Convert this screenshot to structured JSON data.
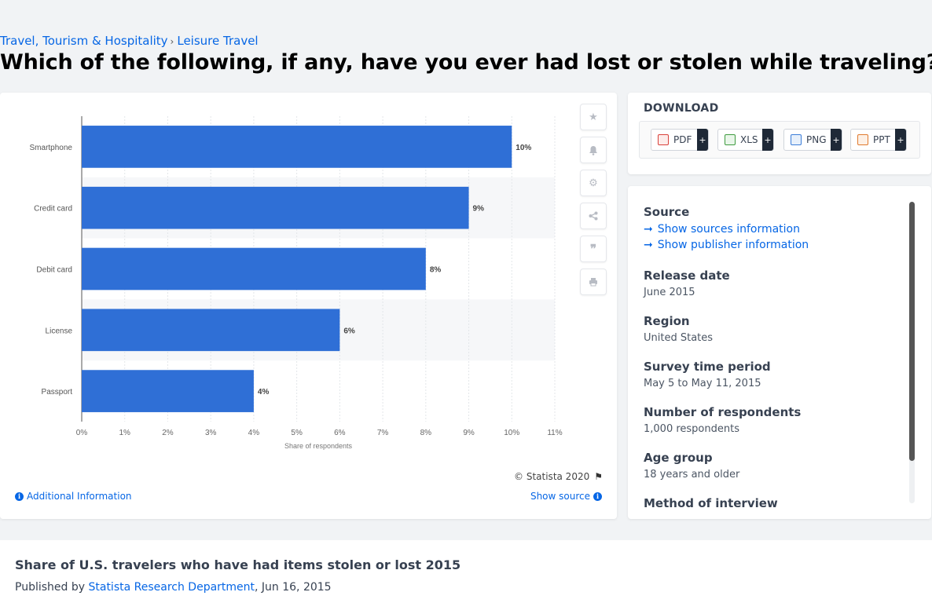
{
  "breadcrumb": {
    "category": "Travel, Tourism & Hospitality",
    "separator": "›",
    "subcategory": "Leisure Travel"
  },
  "page_title": "Which of the following, if any, have you ever had lost or stolen while traveling?",
  "chart_data": {
    "type": "bar",
    "orientation": "horizontal",
    "categories": [
      "Smartphone",
      "Credit card",
      "Debit card",
      "License",
      "Passport"
    ],
    "values": [
      10,
      9,
      8,
      6,
      4
    ],
    "value_labels": [
      "10%",
      "9%",
      "8%",
      "6%",
      "4%"
    ],
    "xlabel": "Share of respondents",
    "ylabel": "",
    "xlim": [
      0,
      11
    ],
    "x_ticks": [
      "0%",
      "1%",
      "2%",
      "3%",
      "4%",
      "5%",
      "6%",
      "7%",
      "8%",
      "9%",
      "10%",
      "11%"
    ],
    "grid": true,
    "bar_color": "#2f6fd6"
  },
  "chart_footer": {
    "copyright": "© Statista 2020",
    "additional_info": "Additional Information",
    "show_source": "Show source"
  },
  "toolbar": {
    "icons": [
      "star-icon",
      "bell-icon",
      "gear-icon",
      "share-icon",
      "quote-icon",
      "print-icon"
    ]
  },
  "download": {
    "title": "DOWNLOAD",
    "buttons": [
      {
        "label": "PDF",
        "plus": "+",
        "color": "#d9413b"
      },
      {
        "label": "XLS",
        "plus": "+",
        "color": "#3e9b3f"
      },
      {
        "label": "PNG",
        "plus": "+",
        "color": "#3b7dd8"
      },
      {
        "label": "PPT",
        "plus": "+",
        "color": "#e07a2e"
      }
    ]
  },
  "details": {
    "source_heading": "Source",
    "show_sources": "Show sources information",
    "show_publisher": "Show publisher information",
    "release_date_heading": "Release date",
    "release_date": "June 2015",
    "region_heading": "Region",
    "region": "United States",
    "survey_period_heading": "Survey time period",
    "survey_period": "May 5 to May 11, 2015",
    "respondents_heading": "Number of respondents",
    "respondents": "1,000 respondents",
    "age_group_heading": "Age group",
    "age_group": "18 years and older",
    "method_heading": "Method of interview"
  },
  "bottom": {
    "title": "Share of U.S. travelers who have had items stolen or lost 2015",
    "published_prefix": "Published by",
    "publisher": "Statista Research Department",
    "date": ", Jun 16, 2015"
  }
}
